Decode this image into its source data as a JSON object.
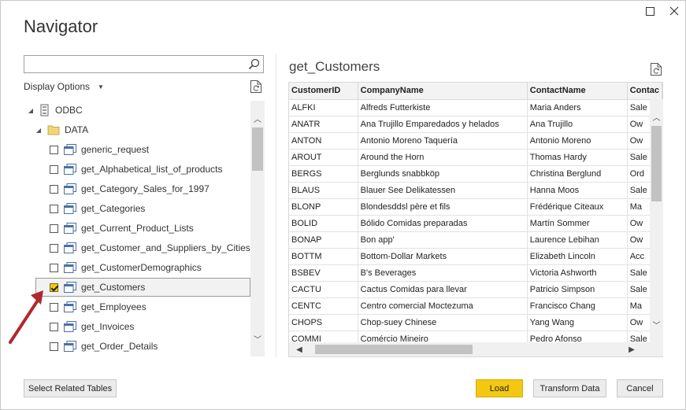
{
  "window": {
    "title": "Navigator",
    "minimize_icon": "maximize-icon",
    "close_icon": "close-icon"
  },
  "left": {
    "search": {
      "value": "",
      "placeholder": ""
    },
    "display_options": "Display Options",
    "tree": {
      "root": "ODBC",
      "folder": "DATA",
      "items": [
        {
          "label": "generic_request",
          "checked": false
        },
        {
          "label": "get_Alphabetical_list_of_products",
          "checked": false
        },
        {
          "label": "get_Category_Sales_for_1997",
          "checked": false
        },
        {
          "label": "get_Categories",
          "checked": false
        },
        {
          "label": "get_Current_Product_Lists",
          "checked": false
        },
        {
          "label": "get_Customer_and_Suppliers_by_Cities",
          "checked": false
        },
        {
          "label": "get_CustomerDemographics",
          "checked": false
        },
        {
          "label": "get_Customers",
          "checked": true,
          "selected": true
        },
        {
          "label": "get_Employees",
          "checked": false
        },
        {
          "label": "get_Invoices",
          "checked": false
        },
        {
          "label": "get_Order_Details",
          "checked": false
        }
      ]
    }
  },
  "preview": {
    "title": "get_Customers",
    "columns": [
      "CustomerID",
      "CompanyName",
      "ContactName",
      "Contac"
    ],
    "rows": [
      [
        "ALFKI",
        "Alfreds Futterkiste",
        "Maria Anders",
        "Sale"
      ],
      [
        "ANATR",
        "Ana Trujillo Emparedados y helados",
        "Ana Trujillo",
        "Ow"
      ],
      [
        "ANTON",
        "Antonio Moreno Taquería",
        "Antonio Moreno",
        "Ow"
      ],
      [
        "AROUT",
        "Around the Horn",
        "Thomas Hardy",
        "Sale"
      ],
      [
        "BERGS",
        "Berglunds snabbköp",
        "Christina Berglund",
        "Ord"
      ],
      [
        "BLAUS",
        "Blauer See Delikatessen",
        "Hanna Moos",
        "Sale"
      ],
      [
        "BLONP",
        "Blondesddsl père et fils",
        "Frédérique Citeaux",
        "Ma"
      ],
      [
        "BOLID",
        "Bólido Comidas preparadas",
        "Martín Sommer",
        "Ow"
      ],
      [
        "BONAP",
        "Bon app'",
        "Laurence Lebihan",
        "Ow"
      ],
      [
        "BOTTM",
        "Bottom-Dollar Markets",
        "Elizabeth Lincoln",
        "Acc"
      ],
      [
        "BSBEV",
        "B's Beverages",
        "Victoria Ashworth",
        "Sale"
      ],
      [
        "CACTU",
        "Cactus Comidas para llevar",
        "Patricio Simpson",
        "Sale"
      ],
      [
        "CENTC",
        "Centro comercial Moctezuma",
        "Francisco Chang",
        "Ma"
      ],
      [
        "CHOPS",
        "Chop-suey Chinese",
        "Yang Wang",
        "Ow"
      ],
      [
        "COMMI",
        "Comércio Mineiro",
        "Pedro Afonso",
        "Sale"
      ]
    ]
  },
  "buttons": {
    "select_related": "Select Related Tables",
    "load": "Load",
    "transform": "Transform Data",
    "cancel": "Cancel"
  },
  "colors": {
    "accent": "#f2c811",
    "annotation_arrow": "#b0282d"
  }
}
